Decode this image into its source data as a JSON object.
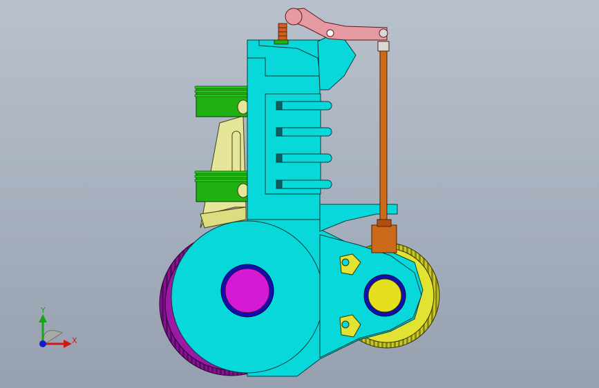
{
  "viewport": {
    "background_top": "#b9c1cc",
    "background_bottom": "#96a0af"
  },
  "model": {
    "colors": {
      "frame": "#08d8da",
      "frame_outline": "#0a3a3a",
      "piston": "#1fb012",
      "rod": "#e6e69a",
      "flywheel": "#9a1aa6",
      "gear": "#e2e233",
      "hub_ring": "#1010b0",
      "hub_center_large": "#d41ad4",
      "hub_center_small": "#e4e020",
      "pushrod": "#cc6a1c",
      "rocker": "#e49aa0",
      "spring": "#d06020"
    }
  },
  "triad": {
    "y_label": "Y",
    "x_label": "X",
    "y_color": "#1aa31a",
    "x_color": "#d01818",
    "z_color": "#1818d0"
  }
}
